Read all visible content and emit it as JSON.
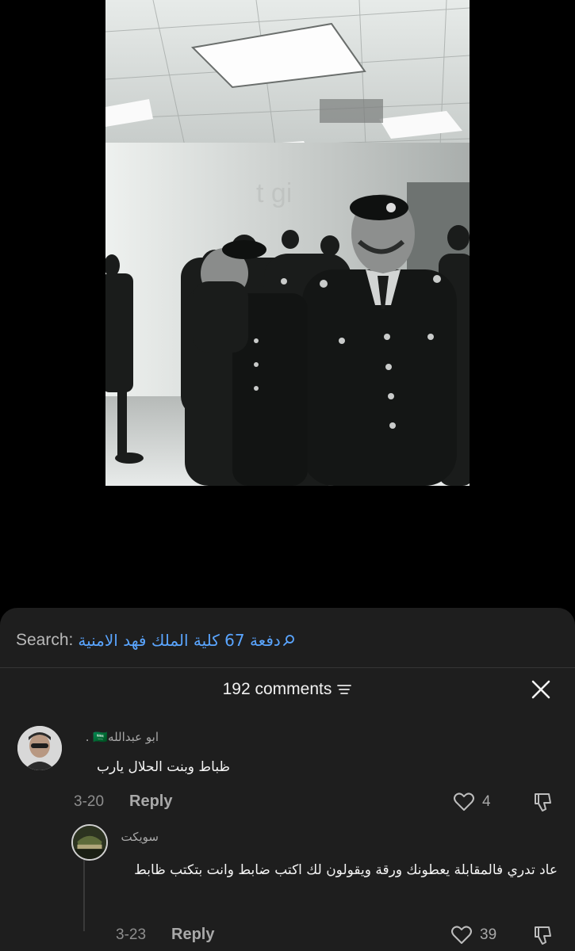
{
  "search": {
    "prefix": "Search:",
    "query": "دفعة 67 كلية الملك فهد الامنية",
    "icon": "search-icon",
    "color": "#5aa5ff"
  },
  "comments_header": {
    "count_label": "192 comments",
    "sort_icon": "sort-icon",
    "close_icon": "close-icon"
  },
  "comments": [
    {
      "username": "ابو عبدالله🇸🇦 .",
      "text": "ظباط وبنت الحلال يارب",
      "date": "3-20",
      "reply_label": "Reply",
      "likes": "4"
    },
    {
      "username": "سويكت",
      "text": "عاد تدري فالمقابلة يعطونك ورقة ويقولون لك اكتب ضابط وانت بتكتب ظابط",
      "date": "3-23",
      "reply_label": "Reply",
      "likes": "39"
    }
  ]
}
